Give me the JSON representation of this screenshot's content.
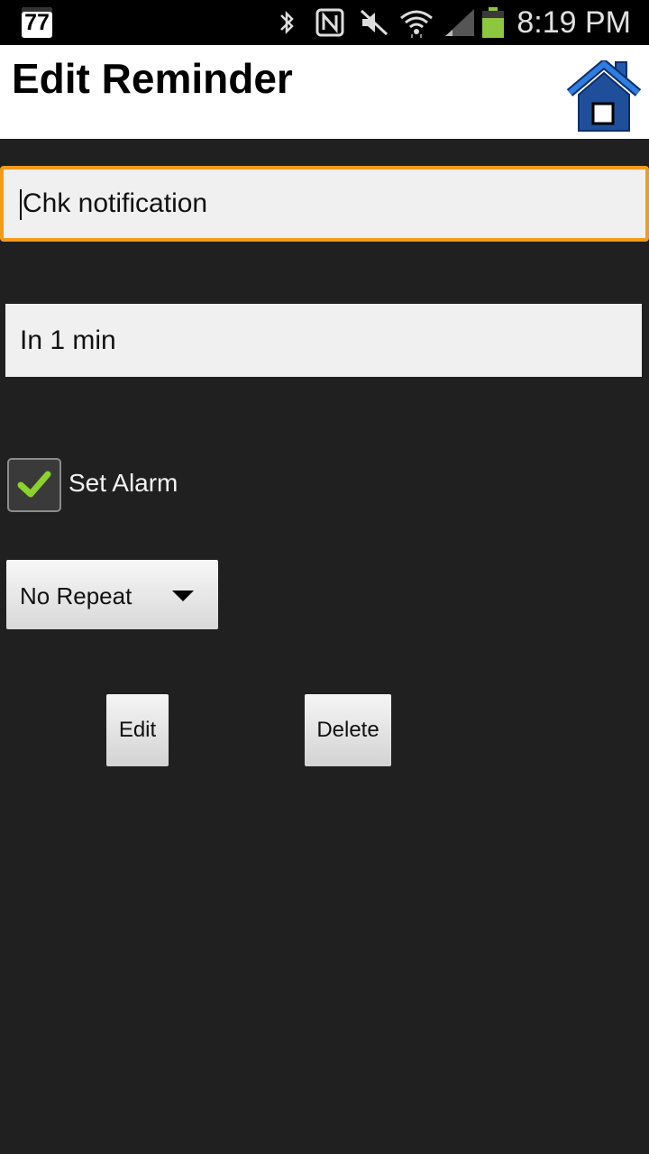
{
  "status_bar": {
    "badge": "77",
    "time": "8:19 PM",
    "icons": [
      "bluetooth-icon",
      "nfc-icon",
      "mute-icon",
      "wifi-icon",
      "signal-icon",
      "battery-icon"
    ]
  },
  "header": {
    "title": "Edit Reminder",
    "home_icon": "home-icon"
  },
  "form": {
    "reminder_text": "Chk notification",
    "time_text": "In 1 min",
    "alarm_label": "Set Alarm",
    "alarm_checked": true,
    "repeat_selected": "No Repeat"
  },
  "actions": {
    "edit_label": "Edit",
    "delete_label": "Delete"
  },
  "colors": {
    "background": "#202020",
    "focus_border": "#f59a1a",
    "checkmark": "#8cd22c",
    "battery": "#8dc63f",
    "home_blue": "#1f5cae"
  }
}
